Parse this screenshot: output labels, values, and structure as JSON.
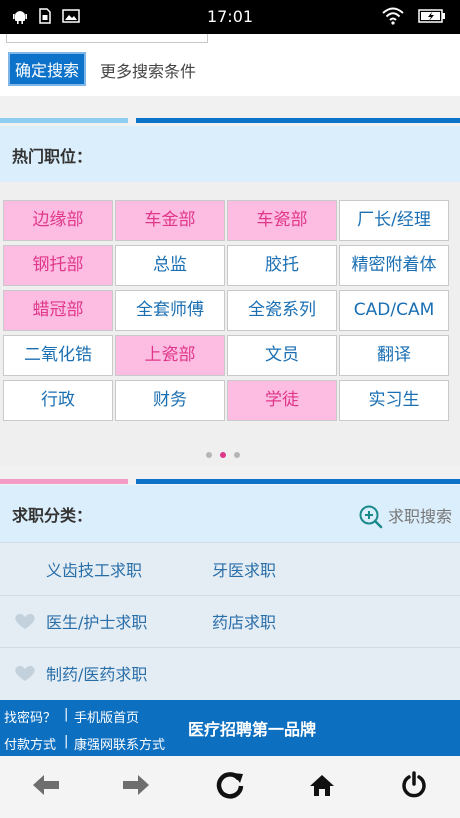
{
  "status": {
    "time": "17:01"
  },
  "search": {
    "confirm_label": "确定搜索",
    "more_label": "更多搜索条件"
  },
  "hot": {
    "title": "热门职位：",
    "rows": [
      [
        {
          "label": "边缘部",
          "pink": true
        },
        {
          "label": "车金部",
          "pink": true
        },
        {
          "label": "车瓷部",
          "pink": true
        },
        {
          "label": "厂长/经理",
          "pink": false
        }
      ],
      [
        {
          "label": "钢托部",
          "pink": true
        },
        {
          "label": "总监",
          "pink": false
        },
        {
          "label": "胶托",
          "pink": false
        },
        {
          "label": "精密附着体",
          "pink": false
        }
      ],
      [
        {
          "label": "蜡冠部",
          "pink": true
        },
        {
          "label": "全套师傅",
          "pink": false
        },
        {
          "label": "全瓷系列",
          "pink": false
        },
        {
          "label": "CAD/CAM",
          "pink": false
        }
      ],
      [
        {
          "label": "二氧化锆",
          "pink": false
        },
        {
          "label": "上瓷部",
          "pink": true
        },
        {
          "label": "文员",
          "pink": false
        },
        {
          "label": "翻译",
          "pink": false
        }
      ],
      [
        {
          "label": "行政",
          "pink": false
        },
        {
          "label": "财务",
          "pink": false
        },
        {
          "label": "学徒",
          "pink": true
        },
        {
          "label": "实习生",
          "pink": false
        }
      ]
    ],
    "page_index": 1,
    "page_count": 3
  },
  "jobs": {
    "title": "求职分类：",
    "search_label": "求职搜索",
    "items": [
      {
        "left": "义齿技工求职",
        "right": "牙医求职"
      },
      {
        "left": "医生/护士求职",
        "right": "药店求职"
      },
      {
        "left": "制药/医药求职",
        "right": ""
      }
    ]
  },
  "footer": {
    "find_password": "找密码？",
    "mobile_home": "手机版首页",
    "payment": "付款方式",
    "contact": "康强网联系方式",
    "separator": "|",
    "brand": "医疗招聘第一品牌"
  },
  "colors": {
    "accent": "#0d72c9",
    "pink": "#fdbde2",
    "pink_text": "#e0378a",
    "light_blue": "#dbeefc"
  }
}
